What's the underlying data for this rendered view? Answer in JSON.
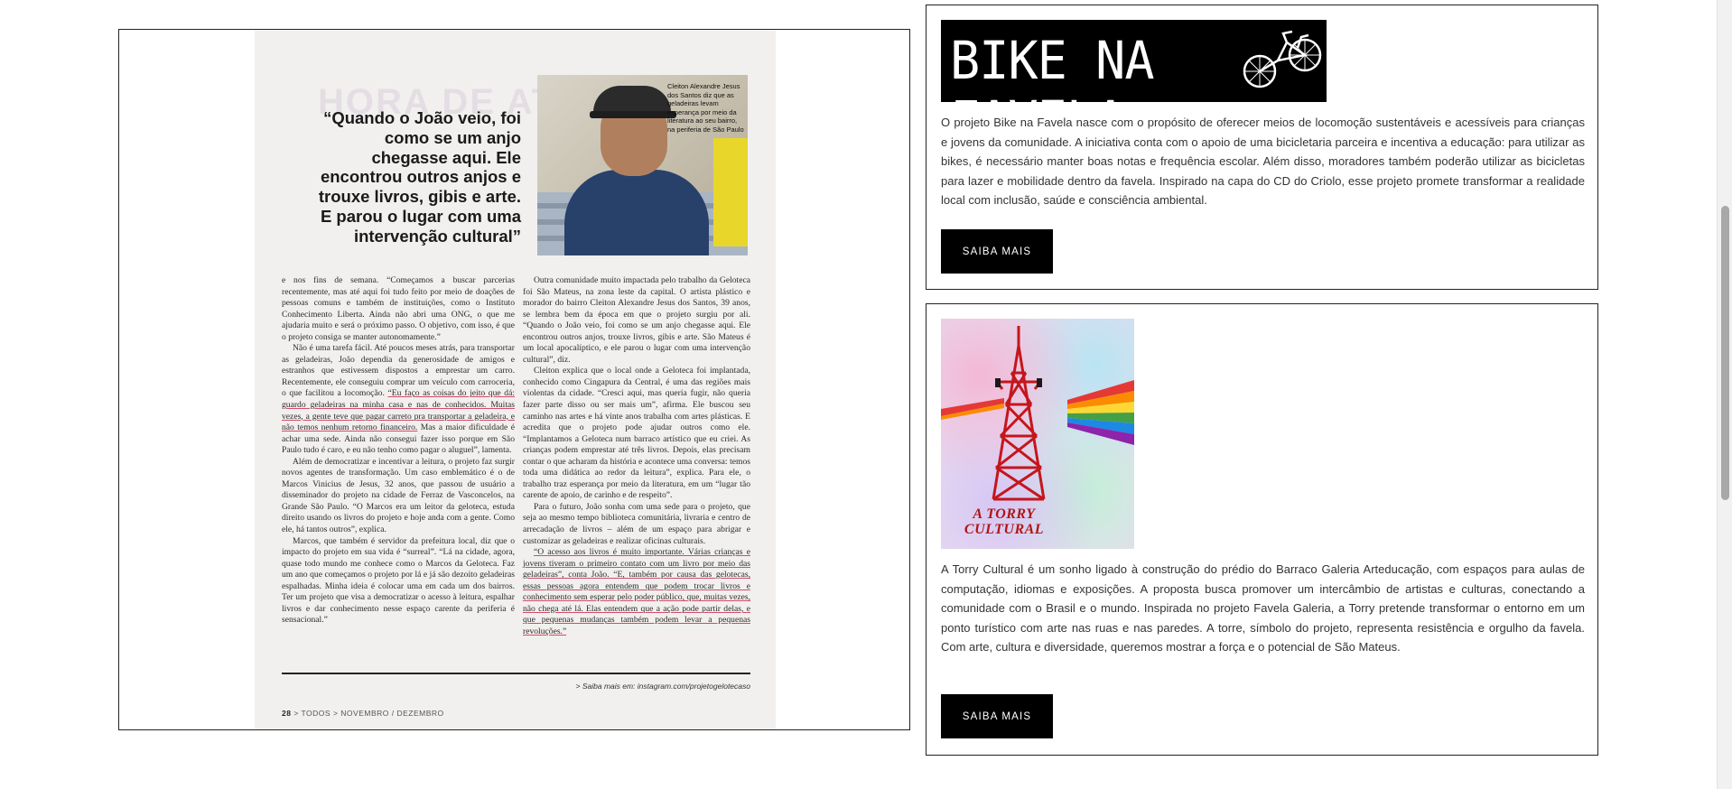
{
  "magazine": {
    "bg_heading": "HORA DE ATA",
    "photo_caption": "Cleiton Alexandre Jesus dos Santos diz que as geladeiras levam esperança por meio da literatura ao seu bairro, na periferia de São Paulo",
    "pull_quote": "“Quando o João veio, foi como se um anjo chegasse aqui. Ele encontrou outros anjos e trouxe livros, gibis e arte. E parou o lugar com uma intervenção cultural”",
    "col_left": [
      "e nos fins de semana. “Começamos a buscar parcerias recentemente, mas até aqui foi tudo feito por meio de doações de pessoas comuns e também de instituições, como o Instituto Conhecimento Liberta. Ainda não abri uma ONG, o que me ajudaria muito e será o próximo passo. O objetivo, com isso, é que o projeto consiga se manter autonomamente.”",
      "Não é uma tarefa fácil. Até poucos meses atrás, para transportar as geladeiras, João dependia da generosidade de amigos e estranhos que estivessem dispostos a emprestar um carro. Recentemente, ele conseguiu comprar um veículo com carroceria, o que facilitou a locomoção.",
      "“Eu faço as coisas do jeito que dá: guardo geladeiras na minha casa e nas de conhecidos. Muitas vezes, a gente teve que pagar carreto pra transportar a geladeira, e não temos nenhum retorno financeiro.",
      "Mas a maior dificuldade é achar uma sede. Ainda não consegui fazer isso porque em São Paulo tudo é caro, e eu não tenho como pagar o aluguel”, lamenta.",
      "Além de democratizar e incentivar a leitura, o projeto faz surgir novos agentes de transformação. Um caso emblemático é o de Marcos Vinicius de Jesus, 32 anos, que passou de usuário a disseminador do projeto na cidade de Ferraz de Vasconcelos, na Grande São Paulo. “O Marcos era um leitor da geloteca, estuda direito usando os livros do projeto e hoje anda com a gente. Como ele, há tantos outros”, explica.",
      "Marcos, que também é servidor da prefeitura local, diz que o impacto do projeto em sua vida é “surreal”. “Lá na cidade, agora, quase todo mundo me conhece como o Marcos da Geloteca. Faz um ano que começamos o projeto por lá e já são dezoito geladeiras espalhadas. Minha ideia é colocar uma em cada um dos bairros. Ter um projeto que visa a democratizar o acesso à leitura, espalhar livros e dar conhecimento nesse espaço carente da periferia é sensacional.”"
    ],
    "col_right": [
      "Outra comunidade muito impactada pelo trabalho da Geloteca foi São Mateus, na zona leste da capital. O artista plástico e morador do bairro Cleiton Alexandre Jesus dos Santos, 39 anos, se lembra bem da época em que o projeto surgiu por ali. “Quando o João veio, foi como se um anjo chegasse aqui. Ele encontrou outros anjos, trouxe livros, gibis e arte. São Mateus é um local apocalíptico, e ele parou o lugar com uma intervenção cultural”, diz.",
      "Cleiton explica que o local onde a Geloteca foi implantada, conhecido como Cingapura da Central, é uma das regiões mais violentas da cidade. “Cresci aqui, mas queria fugir, não queria fazer parte disso ou ser mais um”, afirma. Ele buscou seu caminho nas artes e há vinte anos trabalha com artes plásticas. E acredita que o projeto pode ajudar outros como ele. “Implantamos a Geloteca num barraco artístico que eu criei. As crianças podem emprestar até três livros. Depois, elas precisam contar o que acharam da história e acontece uma conversa: temos toda uma didática ao redor da leitura”, explica. Para ele, o trabalho traz esperança por meio da literatura, em um “lugar tão carente de apoio, de carinho e de respeito”.",
      "Para o futuro, João sonha com uma sede para o projeto, que seja ao mesmo tempo biblioteca comunitária, livraria e centro de arrecadação de livros – além de um espaço para abrigar e customizar as geladeiras e realizar oficinas culturais.",
      "“O acesso aos livros é muito importante. Várias crianças e jovens tiveram o primeiro contato com um livro por meio das geladeiras”, conta João. “E, também por causa das gelotecas, essas pessoas agora entendem que podem trocar livros e conhecimento sem esperar pelo poder público, que, muitas vezes, não chega até lá. Elas entendem que a ação pode partir delas, e que pequenas mudanças também podem levar a pequenas revoluções.”"
    ],
    "source": "> Saiba mais em: instagram.com/projetogelotecaso",
    "footer_page": "28",
    "footer_text": "> TODOS > NOVEMBRO / DEZEMBRO"
  },
  "card_bike": {
    "logo_text": "BIKE NA FAVELA",
    "description": "O projeto Bike na Favela nasce com o propósito de oferecer meios de locomoção sustentáveis e acessíveis para crianças e jovens da comunidade. A iniciativa conta com o apoio de uma bicicletaria parceira e incentiva a educação: para utilizar as bikes, é necessário manter boas notas e frequência escolar. Além disso, moradores também poderão utilizar as bicicletas para lazer e mobilidade dentro da favela. Inspirado na capa do CD do Criolo, esse projeto promete transformar a realidade local com inclusão, saúde e consciência ambiental.",
    "button": "SAIBA MAIS"
  },
  "card_torry": {
    "image_label": "A TORRY CULTURAL",
    "description": "A Torry Cultural é um sonho ligado à construção do prédio do Barraco Galeria Arteducação, com espaços para aulas de computação, idiomas e exposições. A proposta busca promover um intercâmbio de artistas e culturas, conectando a comunidade com o Brasil e o mundo. Inspirada no projeto Favela Galeria, a Torry pretende transformar o entorno em um ponto turístico com arte nas ruas e nas paredes. A torre, símbolo do projeto, representa resistência e orgulho da favela. Com arte, cultura e diversidade, queremos mostrar a força e o potencial de São Mateus.",
    "button": "SAIBA MAIS"
  },
  "colors": {
    "button_bg": "#000000",
    "button_text": "#ffffff",
    "border": "#222222",
    "highlight_underline": "#d64a6a",
    "tower_red": "#c4161c"
  },
  "scroll": {
    "position_fraction": 0.28
  }
}
